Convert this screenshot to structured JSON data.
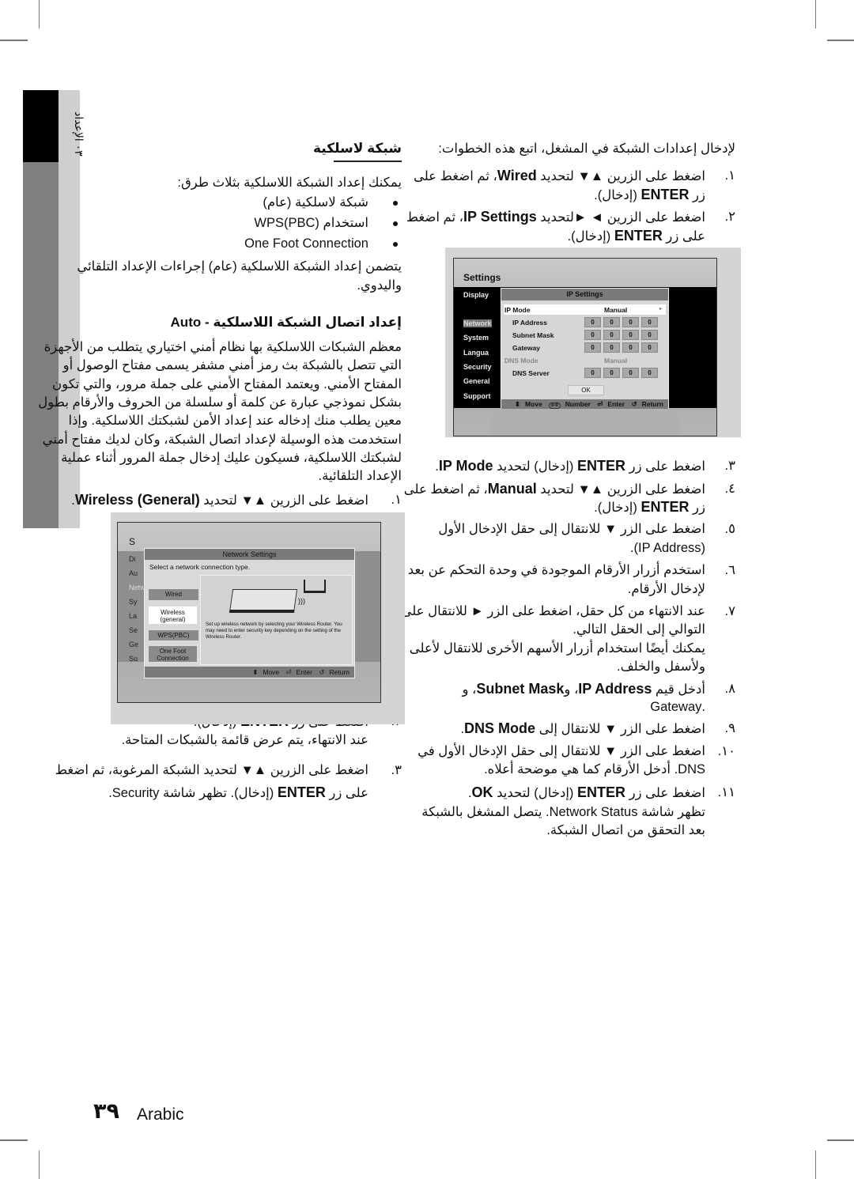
{
  "sidebar": {
    "chapter": "٠٣ الإعداد"
  },
  "right": {
    "intro": "لإدخال إعدادات الشبكة في المشغل، اتبع هذه الخطوات:",
    "steps": [
      {
        "num": "١.",
        "lines": [
          [
            "اضغط على الزرين ▲▼ لتحديد  ",
            "Wired",
            "، ثم اضغط على"
          ],
          [
            "زر ",
            "ENTER",
            " (إدخال)."
          ]
        ]
      },
      {
        "num": "٢.",
        "lines": [
          [
            "اضغط على الزرين ◄ ►لتحديد ",
            "IP Settings",
            "، ثم اضغط"
          ],
          [
            "على زر ",
            "ENTER",
            " (إدخال)."
          ]
        ]
      },
      {
        "num": "٣.",
        "lines": [
          [
            "اضغط على زر ",
            "ENTER",
            " (إدخال) لتحديد ",
            "IP Mode",
            "."
          ]
        ]
      },
      {
        "num": "٤.",
        "lines": [
          [
            "اضغط على الزرين ▲▼ لتحديد ",
            "Manual",
            "، ثم اضغط على"
          ],
          [
            "زر ",
            "ENTER",
            " (إدخال)."
          ]
        ]
      },
      {
        "num": "٥.",
        "lines": [
          [
            "اضغط على الزر ▼ للانتقال إلى حقل الإدخال الأول"
          ],
          [
            "(IP Address)."
          ]
        ]
      },
      {
        "num": "٦.",
        "lines": [
          [
            "استخدم أزرار الأرقام الموجودة في وحدة التحكم عن بعد"
          ],
          [
            "لإدخال الأرقام."
          ]
        ]
      },
      {
        "num": "٧.",
        "lines": [
          [
            "عند الانتهاء من كل حقل، اضغط على الزر ► للانتقال على"
          ],
          [
            "التوالي إلى الحقل التالي."
          ],
          [
            "يمكنك أيضًا استخدام أزرار الأسهم الأخرى للانتقال لأعلى"
          ],
          [
            "ولأسفل والخلف."
          ]
        ]
      },
      {
        "num": "٨.",
        "lines": [
          [
            "أدخل قيم ",
            "IP Address",
            "، و",
            "Subnet Mask",
            "، و"
          ],
          [
            ".Gateway"
          ]
        ]
      },
      {
        "num": "٩.",
        "lines": [
          [
            "اضغط على الزر ▼ للانتقال إلى ",
            "DNS Mode",
            "."
          ]
        ]
      },
      {
        "num": "١٠.",
        "lines": [
          [
            "اضغط على الزر ▼ للانتقال إلى حقل الإدخال الأول في"
          ],
          [
            "DNS. أدخل الأرقام كما هي موضحة أعلاه."
          ]
        ]
      },
      {
        "num": "١١.",
        "lines": [
          [
            "اضغط على زر ",
            "ENTER",
            " (إدخال) لتحديد ",
            "OK",
            "."
          ],
          [
            "تظهر شاشة Network Status. يتصل المشغل بالشبكة"
          ],
          [
            "بعد التحقق من اتصال الشبكة."
          ]
        ]
      }
    ]
  },
  "left": {
    "heading": "شبكة لاسلكية",
    "intro": "يمكنك إعداد الشبكة اللاسلكية بثلاث طرق:",
    "bullets": [
      "شبكة لاسلكية (عام)",
      "استخدام (WPS(PBC",
      "One Foot Connection"
    ],
    "para1": [
      "يتضمن إعداد الشبكة اللاسلكية (عام) إجراءات الإعداد التلقائي",
      "واليدوي."
    ],
    "heading2": "إعداد اتصال الشبكة اللاسلكية - Auto",
    "para2": [
      "معظم الشبكات اللاسلكية بها نظام أمني اختياري يتطلب من الأجهزة",
      "التي تتصل بالشبكة بث رمز أمني مشفر يسمى مفتاح الوصول أو",
      "المفتاح الأمني. ويعتمد المفتاح الأمني على جملة مرور، والتي تكون",
      "بشكل نموذجي عبارة عن كلمة أو سلسلة من الحروف والأرقام بطول",
      "معين يطلب منك إدخاله عند إعداد الأمن لشبكتك اللاسلكية. وإذا",
      "استخدمت هذه الوسيلة لإعداد اتصال الشبكة، وكان لديك مفتاح أمني",
      "لشبكتك اللاسلكية، فسيكون عليك إدخال جملة المرور أثناء عملية",
      "الإعداد التلقائية."
    ],
    "steps": [
      {
        "num": "١.",
        "lines": [
          [
            "اضغط على الزرين ▲▼ لتحديد ",
            "Wireless (General)",
            "."
          ]
        ]
      },
      {
        "num": "٢.",
        "lines": [
          [
            "اضغط على زر ",
            "ENTER",
            " (إدخال)."
          ],
          [
            "عند الانتهاء، يتم عرض قائمة بالشبكات المتاحة."
          ]
        ]
      },
      {
        "num": "٣.",
        "lines": [
          [
            "اضغط على الزرين ▲▼ لتحديد الشبكة المرغوبة، ثم اضغط"
          ],
          [
            "على زر ",
            "ENTER",
            " (إدخال). تظهر شاشة Security."
          ]
        ]
      }
    ]
  },
  "ip_screen": {
    "title": "Settings",
    "menu": [
      "Display",
      "Network",
      "System",
      "Langua",
      "Security",
      "General",
      "Support"
    ],
    "popup_title": "IP Settings",
    "rows": [
      {
        "label": "IP Mode",
        "value": "Manual"
      },
      {
        "label": "IP Address",
        "octets": [
          "0",
          "0",
          "0",
          "0"
        ]
      },
      {
        "label": "Subnet Mask",
        "octets": [
          "0",
          "0",
          "0",
          "0"
        ]
      },
      {
        "label": "Gateway",
        "octets": [
          "0",
          "0",
          "0",
          "0"
        ]
      },
      {
        "label": "DNS Mode",
        "value": "Manual"
      },
      {
        "label": "DNS Server",
        "octets": [
          "0",
          "0",
          "0",
          "0"
        ]
      }
    ],
    "ok": "OK",
    "footer": {
      "move": "Move",
      "number_key": "0-9",
      "number": "Number",
      "enter": "Enter",
      "return": "Return"
    }
  },
  "net_screen": {
    "title": "S",
    "menu": [
      "Di",
      "Au",
      "Netw",
      "Sy",
      "La",
      "Se",
      "Ge",
      "Su"
    ],
    "popup_title": "Network Settings",
    "prompt": "Select a network connection type.",
    "options": [
      "Wired",
      "Wireless (general)",
      "WPS(PBC)",
      "One Foot Connection"
    ],
    "description": "Set up wireless network by selecting your Wireless Router. You may need to enter security key depending on the setting of the Wireless Router.",
    "footer": {
      "move": "Move",
      "enter": "Enter",
      "return": "Return"
    }
  },
  "footer": {
    "page_number": "٣٩",
    "language": "Arabic"
  }
}
